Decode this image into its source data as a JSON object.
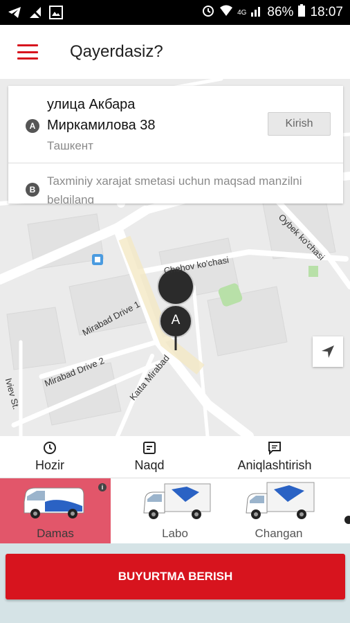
{
  "status_bar": {
    "battery": "86%",
    "time": "18:07",
    "network": "4G"
  },
  "app_bar": {
    "title": "Qayerdasiz?"
  },
  "address": {
    "pickup_badge": "A",
    "pickup_line1": "улица Акбара",
    "pickup_line2": "Миркамилова 38",
    "pickup_city": "Ташкент",
    "kirish_label": "Kirish",
    "dest_badge": "B",
    "dest_placeholder": "Taxminiy xarajat smetasi uchun maqsad manzilni belgilang"
  },
  "map": {
    "pin_label": "A",
    "streets": [
      "Chehov ko'chasi",
      "Mirabad Drive 1",
      "Mirabad Drive 2",
      "Katta Mirabad",
      "Oybek ko'chasi",
      "Iviev St."
    ]
  },
  "options": {
    "time": "Hozir",
    "payment": "Naqd",
    "details": "Aniqlashtirish"
  },
  "vehicles": [
    {
      "name": "Damas",
      "selected": true
    },
    {
      "name": "Labo",
      "selected": false
    },
    {
      "name": "Changan",
      "selected": false
    }
  ],
  "info_badge": "i",
  "order_button": "BUYURTMA BERISH",
  "colors": {
    "brand_red": "#d7141e",
    "selected_vehicle": "#e2566a",
    "bottom_bg": "#d5e3e6"
  }
}
